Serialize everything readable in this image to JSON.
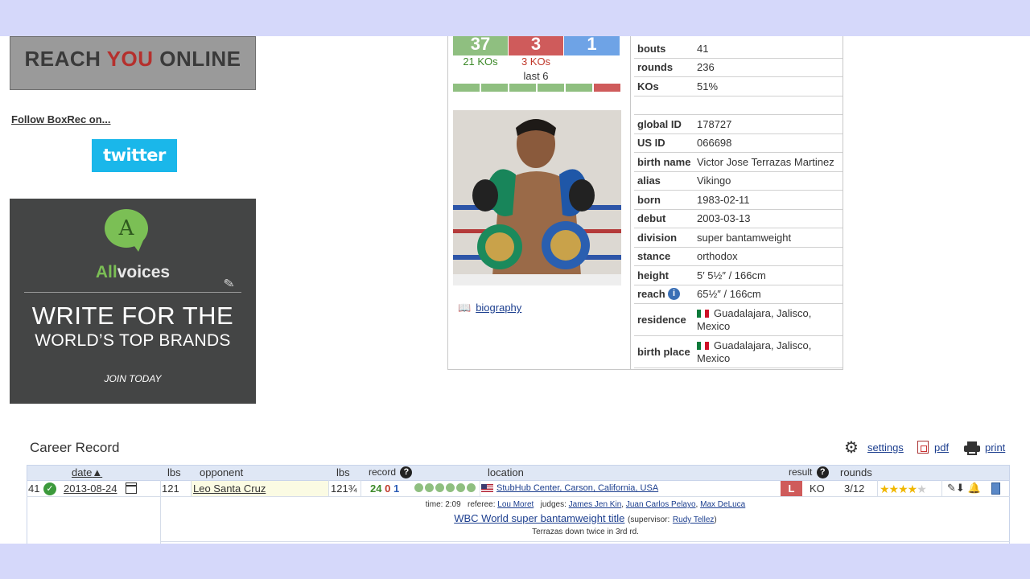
{
  "left": {
    "ad_top": {
      "pre": "REACH ",
      "highlight": "YOU",
      "post": " ONLINE"
    },
    "follow": "Follow BoxRec on...",
    "twitter": "twitter",
    "ad_big": {
      "bubble": "A",
      "brand_pre": "All",
      "brand_post": "voices",
      "headline1": "WRITE FOR THE",
      "headline2": "WORLD’S TOP BRANDS",
      "cta": "JOIN TODAY"
    }
  },
  "profile": {
    "record": {
      "wins": "37",
      "losses": "3",
      "draws": "1",
      "win_kos": "21 KOs",
      "loss_kos": "3 KOs",
      "last6_label": "last 6"
    },
    "last6": [
      "win",
      "win",
      "win",
      "win",
      "win",
      "loss"
    ],
    "biography": "biography",
    "rows": [
      {
        "k": "bouts",
        "v": "41"
      },
      {
        "k": "rounds",
        "v": "236"
      },
      {
        "k": "KOs",
        "v": "51%"
      },
      {
        "k": "",
        "v": ""
      },
      {
        "k": "global ID",
        "v": "178727"
      },
      {
        "k": "US ID",
        "v": "066698"
      },
      {
        "k": "birth name",
        "v": "Victor Jose Terrazas Martinez"
      },
      {
        "k": "alias",
        "v": "Vikingo"
      },
      {
        "k": "born",
        "v": "1983-02-11"
      },
      {
        "k": "debut",
        "v": "2003-03-13"
      },
      {
        "k": "division",
        "v": "super bantamweight"
      },
      {
        "k": "stance",
        "v": "orthodox"
      },
      {
        "k": "height",
        "v": "5′ 5½″   /   166cm"
      },
      {
        "k": "reach",
        "v": "65½″   /   166cm"
      },
      {
        "k": "residence",
        "v": "Guadalajara, Jalisco, Mexico"
      },
      {
        "k": "birth place",
        "v": "Guadalajara, Jalisco, Mexico"
      }
    ]
  },
  "career": {
    "title": "Career Record",
    "settings": "settings",
    "pdf": "pdf",
    "print": "print",
    "headers": {
      "date": "date",
      "lbs": "lbs",
      "opponent": "opponent",
      "lbs2": "lbs",
      "record": "record",
      "location": "location",
      "result": "result",
      "rounds": "rounds"
    },
    "bout": {
      "num": "41",
      "date": "2013-08-24",
      "lbs": "121",
      "opponent": "Leo Santa Cruz",
      "opp_lbs": "121¾",
      "opp_w": "24",
      "opp_l": "0",
      "opp_d": "1",
      "location": "StubHub Center, Carson, California, USA",
      "result": "L",
      "method": "KO",
      "rounds": "3/12",
      "time_label": "time:",
      "time": "2:09",
      "referee_label": "referee:",
      "referee": "Lou Moret",
      "judges_label": "judges:",
      "judge1": "James Jen Kin",
      "judge2": "Juan Carlos Pelayo",
      "judge3": "Max DeLuca",
      "title": "WBC World super bantamweight title",
      "supervisor_label": "(supervisor:",
      "supervisor": "Rudy Tellez",
      "supervisor_close": ")",
      "note": "Terrazas down twice in 3rd rd."
    }
  },
  "colors": {
    "win": "#8fbf80",
    "loss": "#cf5b5b",
    "draw": "#6ea3e6",
    "band": "#d5d8fa",
    "header": "#dfe7f5"
  }
}
